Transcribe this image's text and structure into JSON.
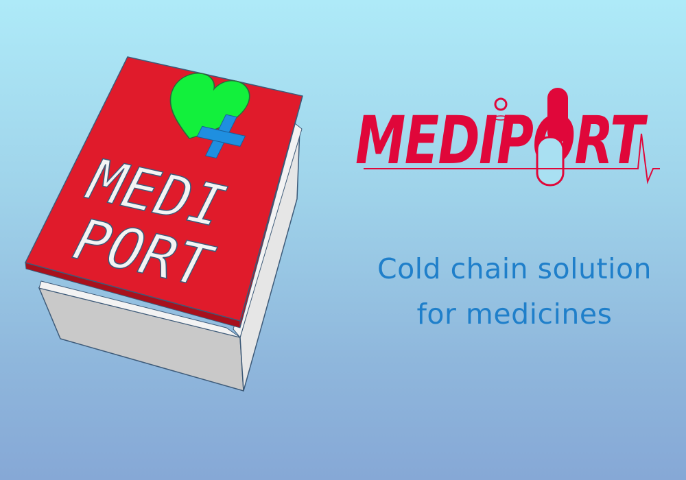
{
  "product": {
    "lid_text_line1": "MEDI",
    "lid_text_line2": "PORT",
    "colors": {
      "lid": "#e01b2b",
      "heart": "#12f03c",
      "cross": "#1f8fe0",
      "body": "#d9d9d9"
    }
  },
  "logo": {
    "text": "MEDIPORT",
    "color": "#e0073a"
  },
  "tagline": {
    "line1": "Cold chain solution",
    "line2": "for medicines",
    "color": "#1f7fca"
  }
}
